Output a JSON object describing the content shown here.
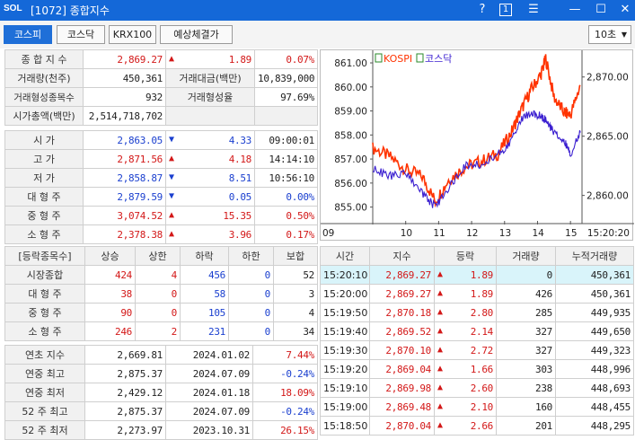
{
  "window": {
    "logo": "SOL",
    "title": "[1072] 종합지수",
    "help": "?",
    "num": "1",
    "menu": "☰",
    "minimize": "—",
    "maximize": "☐",
    "close": "✕"
  },
  "toolbar": {
    "tabs": [
      "코스피",
      "코스닥",
      "KRX100",
      "예상체결가"
    ],
    "interval": "10초"
  },
  "summary": {
    "r1": {
      "l": "종 합 지 수",
      "v": "2,869.27",
      "chg": "1.89",
      "pct": "0.07%"
    },
    "r2": {
      "l": "거래량(천주)",
      "v": "450,361",
      "l2": "거래대금(백만)",
      "v2": "10,839,000"
    },
    "r3": {
      "l": "거래형성종목수",
      "v": "932",
      "l2": "거래형성율",
      "v2": "97.69%"
    },
    "r4": {
      "l": "시가총액(백만)",
      "v": "2,514,718,702"
    }
  },
  "prices": [
    {
      "l": "시 가",
      "v": "2,863.05",
      "d": "4.33",
      "t": "09:00:01"
    },
    {
      "l": "고 가",
      "v": "2,871.56",
      "d": "4.18",
      "t": "14:14:10"
    },
    {
      "l": "저 가",
      "v": "2,858.87",
      "d": "8.51",
      "t": "10:56:10"
    },
    {
      "l": "대 형 주",
      "v": "2,879.59",
      "d": "0.05",
      "t": "0.00%"
    },
    {
      "l": "중 형 주",
      "v": "3,074.52",
      "d": "15.35",
      "t": "0.50%"
    },
    {
      "l": "소 형 주",
      "v": "2,378.38",
      "d": "3.96",
      "t": "0.17%"
    }
  ],
  "breadth": {
    "headers": [
      "[등락종목수]",
      "상승",
      "상한",
      "하락",
      "하한",
      "보합"
    ],
    "rows": [
      {
        "l": "시장종합",
        "v": [
          "424",
          "4",
          "456",
          "0",
          "52"
        ]
      },
      {
        "l": "대 형 주",
        "v": [
          "38",
          "0",
          "58",
          "0",
          "3"
        ]
      },
      {
        "l": "중 형 주",
        "v": [
          "90",
          "0",
          "105",
          "0",
          "4"
        ]
      },
      {
        "l": "소 형 주",
        "v": [
          "246",
          "2",
          "231",
          "0",
          "34"
        ]
      }
    ]
  },
  "hist": [
    {
      "l": "연초 지수",
      "v": "2,669.81",
      "d": "2024.01.02",
      "p": "7.44%"
    },
    {
      "l": "연중 최고",
      "v": "2,875.37",
      "d": "2024.07.09",
      "p": "-0.24%"
    },
    {
      "l": "연중 최저",
      "v": "2,429.12",
      "d": "2024.01.18",
      "p": "18.09%"
    },
    {
      "l": "52 주 최고",
      "v": "2,875.37",
      "d": "2024.07.09",
      "p": "-0.24%"
    },
    {
      "l": "52 주 최저",
      "v": "2,273.97",
      "d": "2023.10.31",
      "p": "26.15%"
    }
  ],
  "ticks": {
    "headers": [
      "시간",
      "지수",
      "등락",
      "거래량",
      "누적거래량"
    ],
    "rows": [
      {
        "t": "15:20:10",
        "v": "2,869.27",
        "c": "1.89",
        "q": "0",
        "a": "450,361"
      },
      {
        "t": "15:20:00",
        "v": "2,869.27",
        "c": "1.89",
        "q": "426",
        "a": "450,361"
      },
      {
        "t": "15:19:50",
        "v": "2,870.18",
        "c": "2.80",
        "q": "285",
        "a": "449,935"
      },
      {
        "t": "15:19:40",
        "v": "2,869.52",
        "c": "2.14",
        "q": "327",
        "a": "449,650"
      },
      {
        "t": "15:19:30",
        "v": "2,870.10",
        "c": "2.72",
        "q": "327",
        "a": "449,323"
      },
      {
        "t": "15:19:20",
        "v": "2,869.04",
        "c": "1.66",
        "q": "303",
        "a": "448,996"
      },
      {
        "t": "15:19:10",
        "v": "2,869.98",
        "c": "2.60",
        "q": "238",
        "a": "448,693"
      },
      {
        "t": "15:19:00",
        "v": "2,869.48",
        "c": "2.10",
        "q": "160",
        "a": "448,455"
      },
      {
        "t": "15:18:50",
        "v": "2,870.04",
        "c": "2.66",
        "q": "201",
        "a": "448,295"
      }
    ]
  },
  "chart_data": {
    "type": "line",
    "legend": [
      "KOSPI",
      "코스닥"
    ],
    "x_ticks": [
      "09",
      "10",
      "11",
      "12",
      "13",
      "14",
      "15",
      "15:20:20"
    ],
    "y_left_ticks": [
      "861.00",
      "860.00",
      "859.00",
      "858.00",
      "857.00",
      "856.00",
      "855.00"
    ],
    "y_right_ticks": [
      "2,870.00",
      "2,865.00",
      "2,860.00"
    ],
    "y_left_range": [
      854.5,
      861.3
    ],
    "y_right_range": [
      2858.0,
      2871.8
    ],
    "series": [
      {
        "name": "KOSPI",
        "axis": "right",
        "color": "#ff3300",
        "x": [
          9.0,
          9.5,
          10.0,
          10.5,
          10.9,
          11.3,
          11.8,
          12.3,
          12.8,
          13.2,
          13.5,
          13.8,
          14.1,
          14.25,
          14.5,
          14.8,
          15.0,
          15.3
        ],
        "values": [
          2864.0,
          2863.3,
          2862.2,
          2861.6,
          2859.5,
          2861.3,
          2862.4,
          2862.9,
          2863.5,
          2865.3,
          2867.2,
          2868.9,
          2870.2,
          2871.56,
          2868.3,
          2867.0,
          2866.8,
          2869.3
        ]
      },
      {
        "name": "코스닥",
        "axis": "left",
        "color": "#3b1fd0",
        "x": [
          9.0,
          9.5,
          10.0,
          10.5,
          10.9,
          11.3,
          11.8,
          12.3,
          12.8,
          13.2,
          13.5,
          13.8,
          14.1,
          14.25,
          14.5,
          14.8,
          15.0,
          15.3
        ],
        "values": [
          856.6,
          856.3,
          856.4,
          855.6,
          855.0,
          855.8,
          856.7,
          856.8,
          857.2,
          857.7,
          858.7,
          858.9,
          858.8,
          858.6,
          858.1,
          857.8,
          857.2,
          858.1
        ]
      }
    ]
  }
}
